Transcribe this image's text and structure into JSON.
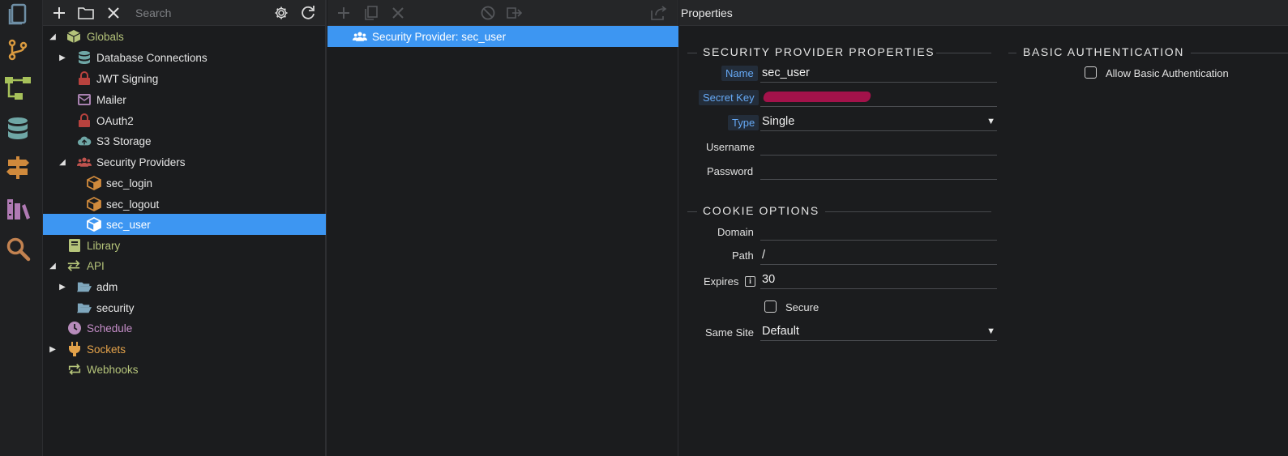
{
  "tree_toolbar": {
    "add_icon": "plus-icon",
    "folder_icon": "folder-icon",
    "delete_icon": "close-icon",
    "search_placeholder": "Search",
    "settings_icon": "gear-icon",
    "refresh_icon": "refresh-icon"
  },
  "rail": {
    "items": [
      "files-icon",
      "git-branch-icon",
      "flow-icon",
      "database-icon",
      "signpost-icon",
      "library-icon",
      "search-icon"
    ]
  },
  "tree": {
    "items": [
      {
        "label": "Globals",
        "color": "#b5c47a"
      },
      {
        "label": "Database Connections",
        "color": "#e6e6e6"
      },
      {
        "label": "JWT Signing",
        "color": "#e6e6e6"
      },
      {
        "label": "Mailer",
        "color": "#e6e6e6"
      },
      {
        "label": "OAuth2",
        "color": "#e6e6e6"
      },
      {
        "label": "S3 Storage",
        "color": "#e6e6e6"
      },
      {
        "label": "Security Providers",
        "color": "#e6e6e6"
      },
      {
        "label": "sec_login",
        "color": "#e6e6e6"
      },
      {
        "label": "sec_logout",
        "color": "#e6e6e6"
      },
      {
        "label": "sec_user",
        "color": "#ffffff"
      },
      {
        "label": "Library",
        "color": "#b5c47a"
      },
      {
        "label": "API",
        "color": "#b5c47a"
      },
      {
        "label": "adm",
        "color": "#e6e6e6"
      },
      {
        "label": "security",
        "color": "#e6e6e6"
      },
      {
        "label": "Schedule",
        "color": "#c68ec9"
      },
      {
        "label": "Sockets",
        "color": "#e3a24a"
      },
      {
        "label": "Webhooks",
        "color": "#b5c47a"
      }
    ]
  },
  "middle": {
    "selected_item": "Security Provider: sec_user"
  },
  "properties": {
    "header": "Properties",
    "section_security": "SECURITY PROVIDER PROPERTIES",
    "section_basic": "BASIC AUTHENTICATION",
    "section_cookie": "COOKIE OPTIONS",
    "name_label": "Name",
    "name_value": "sec_user",
    "secret_key_label": "Secret Key",
    "type_label": "Type",
    "type_value": "Single",
    "username_label": "Username",
    "username_value": "",
    "password_label": "Password",
    "password_value": "",
    "allow_basic_label": "Allow Basic Authentication",
    "allow_basic_checked": false,
    "domain_label": "Domain",
    "domain_value": "",
    "path_label": "Path",
    "path_value": "/",
    "expires_label": "Expires",
    "expires_value": "30",
    "secure_label": "Secure",
    "secure_checked": false,
    "same_site_label": "Same Site",
    "same_site_value": "Default"
  },
  "colors": {
    "accent": "#3d96f2",
    "link_label": "#66a9f5",
    "redaction": "#a3124a"
  }
}
